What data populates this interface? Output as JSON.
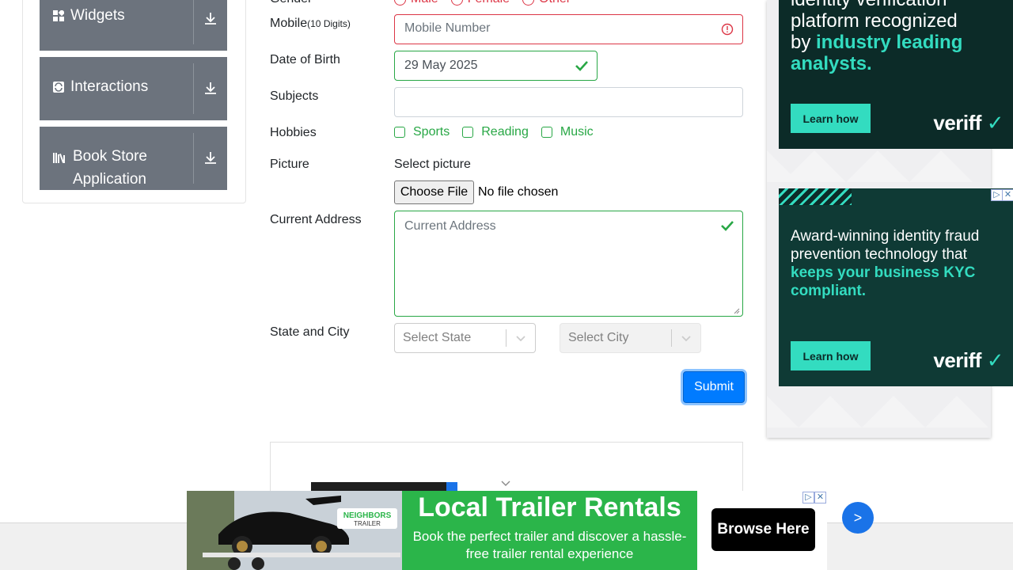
{
  "sidebar": {
    "groups": [
      {
        "label": "Widgets",
        "icon": "widgets-icon"
      },
      {
        "label": "Interactions",
        "icon": "interactions-icon"
      },
      {
        "label": "Book Store Application",
        "label_line1": "Book Store",
        "label_line2": "Application",
        "icon": "books-icon"
      }
    ]
  },
  "form": {
    "gender": {
      "label": "Gender",
      "options": [
        "Male",
        "Female",
        "Other"
      ]
    },
    "mobile": {
      "label": "Mobile",
      "hint": "(10 Digits)",
      "placeholder": "Mobile Number",
      "state": "invalid"
    },
    "dob": {
      "label": "Date of Birth",
      "value": "29 May 2025",
      "state": "valid"
    },
    "subjects": {
      "label": "Subjects",
      "value": ""
    },
    "hobbies": {
      "label": "Hobbies",
      "options": [
        "Sports",
        "Reading",
        "Music"
      ]
    },
    "picture": {
      "label": "Picture",
      "caption": "Select picture",
      "button": "Choose File",
      "status": "No file chosen"
    },
    "address": {
      "label": "Current Address",
      "placeholder": "Current Address",
      "state": "valid"
    },
    "state_city": {
      "label": "State and City",
      "state_placeholder": "Select State",
      "city_placeholder": "Select City"
    },
    "submit": "Submit"
  },
  "ads": {
    "top": {
      "line1": "identity verification",
      "line2": "platform recognized",
      "line3a": "by ",
      "line3b": "industry leading",
      "line4": "analysts.",
      "button": "Learn how",
      "brand": "veriff"
    },
    "middle": {
      "text_a": "Award-winning identity fraud prevention technology that ",
      "text_b": "keeps your business KYC compliant.",
      "button": "Learn how",
      "brand": "veriff"
    },
    "banner": {
      "title": "Local Trailer Rentals",
      "subtitle": "Book the perfect trailer and discover a hassle-free trailer rental experience",
      "button": "Browse Here",
      "logo": "NEIGHBORS TRAILER"
    }
  },
  "scroll_button": ">",
  "colors": {
    "accent": "#007bff",
    "valid": "#28a745",
    "invalid": "#dc3545",
    "sidebar": "#6c737d",
    "ad_dark": "#0c2b28",
    "ad_teal": "#33dcc0",
    "banner_green": "#2bb54a"
  }
}
